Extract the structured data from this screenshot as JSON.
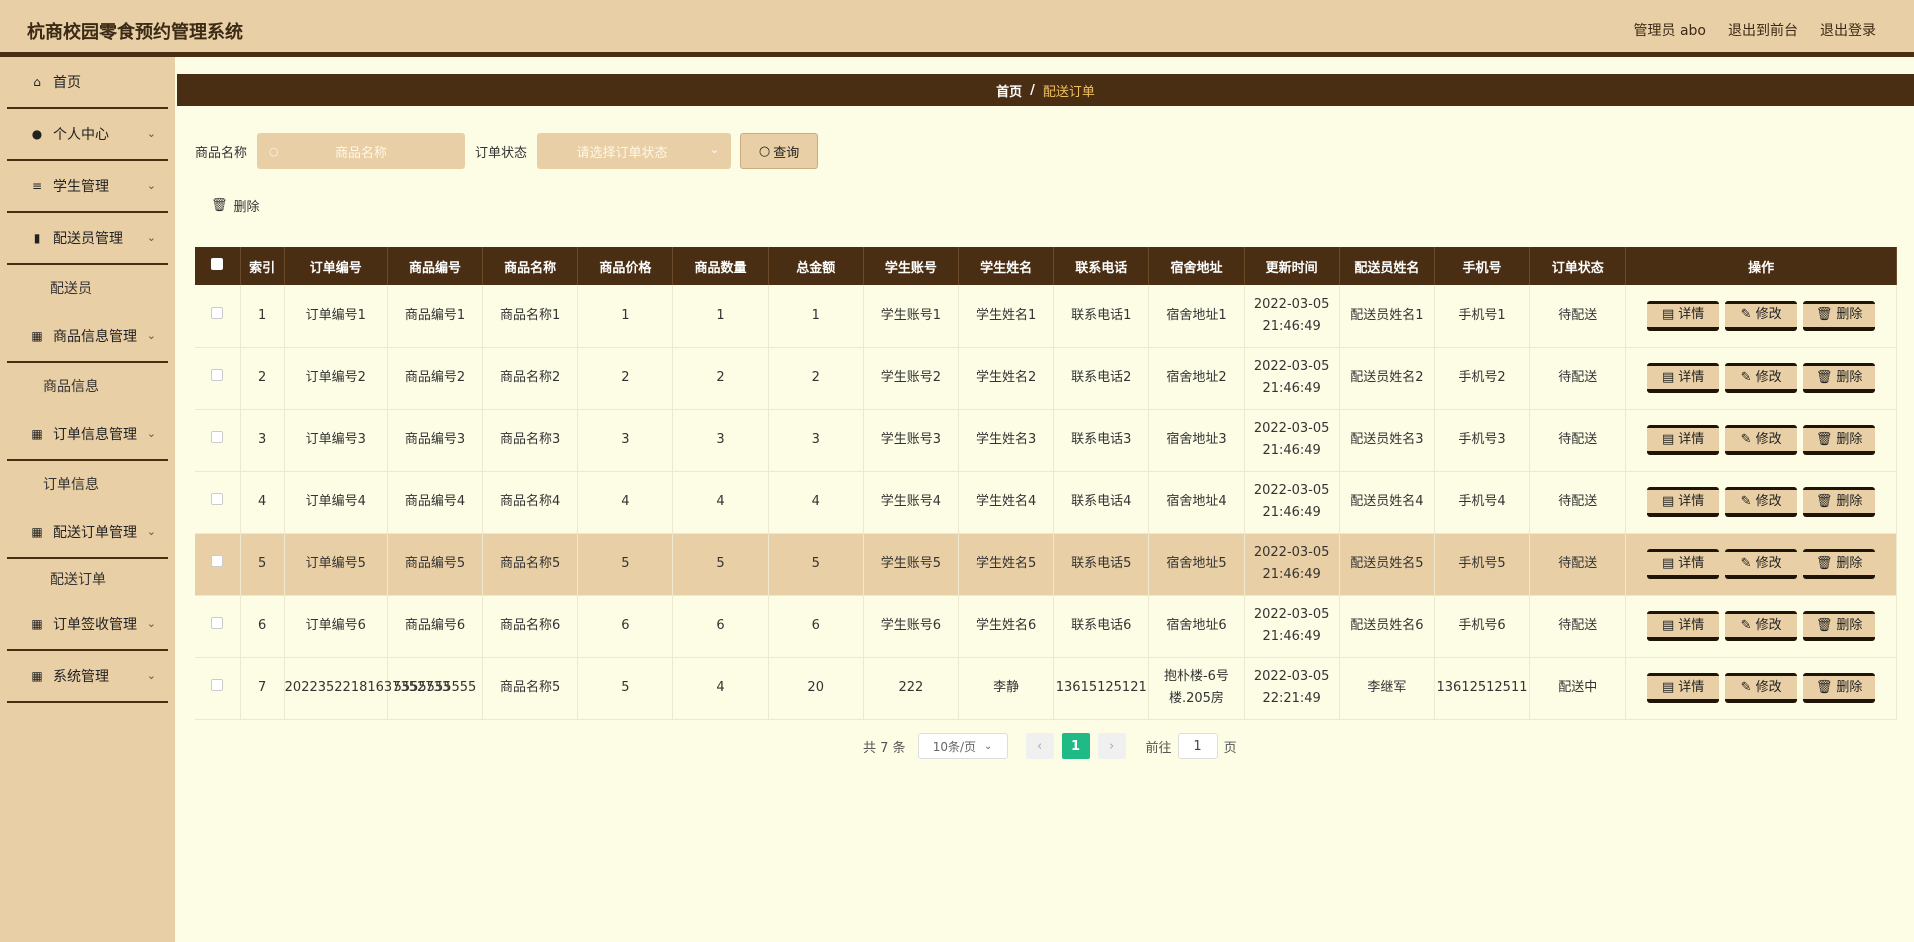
{
  "header": {
    "title": "杭商校园零食预约管理系统",
    "admin": "管理员 abo",
    "to_front": "退出到前台",
    "logout": "退出登录"
  },
  "sidebar": {
    "items": [
      {
        "label": "首页",
        "icon": "home-icon"
      },
      {
        "label": "个人中心",
        "icon": "user-icon"
      },
      {
        "label": "学生管理",
        "icon": "list-icon"
      },
      {
        "label": "配送员管理",
        "icon": "book-icon"
      },
      {
        "label": "配送员"
      },
      {
        "label": "商品信息管理",
        "icon": "grid-icon"
      },
      {
        "label": "商品信息"
      },
      {
        "label": "订单信息管理",
        "icon": "grid-icon"
      },
      {
        "label": "订单信息"
      },
      {
        "label": "配送订单管理",
        "icon": "grid-icon"
      },
      {
        "label": "配送订单"
      },
      {
        "label": "订单签收管理",
        "icon": "grid-icon"
      },
      {
        "label": "系统管理",
        "icon": "grid-icon"
      }
    ]
  },
  "breadcrumb": {
    "home": "首页",
    "sep": "/",
    "current": "配送订单"
  },
  "filter": {
    "name_label": "商品名称",
    "name_placeholder": "商品名称",
    "status_label": "订单状态",
    "status_placeholder": "请选择订单状态",
    "search_label": "查询"
  },
  "delete_label": "删除",
  "table": {
    "headers": [
      "索引",
      "订单编号",
      "商品编号",
      "商品名称",
      "商品价格",
      "商品数量",
      "总金额",
      "学生账号",
      "学生姓名",
      "联系电话",
      "宿舍地址",
      "更新时间",
      "配送员姓名",
      "手机号",
      "订单状态",
      "操作"
    ],
    "rows": [
      [
        "1",
        "订单编号1",
        "商品编号1",
        "商品名称1",
        "1",
        "1",
        "1",
        "学生账号1",
        "学生姓名1",
        "联系电话1",
        "宿舍地址1",
        "2022-03-05 21:46:49",
        "配送员姓名1",
        "手机号1",
        "待配送"
      ],
      [
        "2",
        "订单编号2",
        "商品编号2",
        "商品名称2",
        "2",
        "2",
        "2",
        "学生账号2",
        "学生姓名2",
        "联系电话2",
        "宿舍地址2",
        "2022-03-05 21:46:49",
        "配送员姓名2",
        "手机号2",
        "待配送"
      ],
      [
        "3",
        "订单编号3",
        "商品编号3",
        "商品名称3",
        "3",
        "3",
        "3",
        "学生账号3",
        "学生姓名3",
        "联系电话3",
        "宿舍地址3",
        "2022-03-05 21:46:49",
        "配送员姓名3",
        "手机号3",
        "待配送"
      ],
      [
        "4",
        "订单编号4",
        "商品编号4",
        "商品名称4",
        "4",
        "4",
        "4",
        "学生账号4",
        "学生姓名4",
        "联系电话4",
        "宿舍地址4",
        "2022-03-05 21:46:49",
        "配送员姓名4",
        "手机号4",
        "待配送"
      ],
      [
        "5",
        "订单编号5",
        "商品编号5",
        "商品名称5",
        "5",
        "5",
        "5",
        "学生账号5",
        "学生姓名5",
        "联系电话5",
        "宿舍地址5",
        "2022-03-05 21:46:49",
        "配送员姓名5",
        "手机号5",
        "待配送"
      ],
      [
        "6",
        "订单编号6",
        "商品编号6",
        "商品名称6",
        "6",
        "6",
        "6",
        "学生账号6",
        "学生姓名6",
        "联系电话6",
        "宿舍地址6",
        "2022-03-05 21:46:49",
        "配送员姓名6",
        "手机号6",
        "待配送"
      ],
      [
        "7",
        "20223522181637352733",
        "5555555555",
        "商品名称5",
        "5",
        "4",
        "20",
        "222",
        "李静",
        "13615125121",
        "抱朴楼-6号楼.205房",
        "2022-03-05 22:21:49",
        "李继军",
        "13612512511",
        "配送中"
      ]
    ],
    "highlight_row": 4,
    "ops": {
      "detail": "详情",
      "edit": "修改",
      "delete": "删除"
    }
  },
  "pagination": {
    "total": "共 7 条",
    "page_size": "10条/页",
    "current": "1",
    "goto_label": "前往",
    "goto_value": "1",
    "page_suffix": "页"
  },
  "colors": {
    "accent": "#e9cfa5",
    "dark": "#4a2e14",
    "bg": "#fdfde6",
    "active_page": "#1fba86"
  }
}
